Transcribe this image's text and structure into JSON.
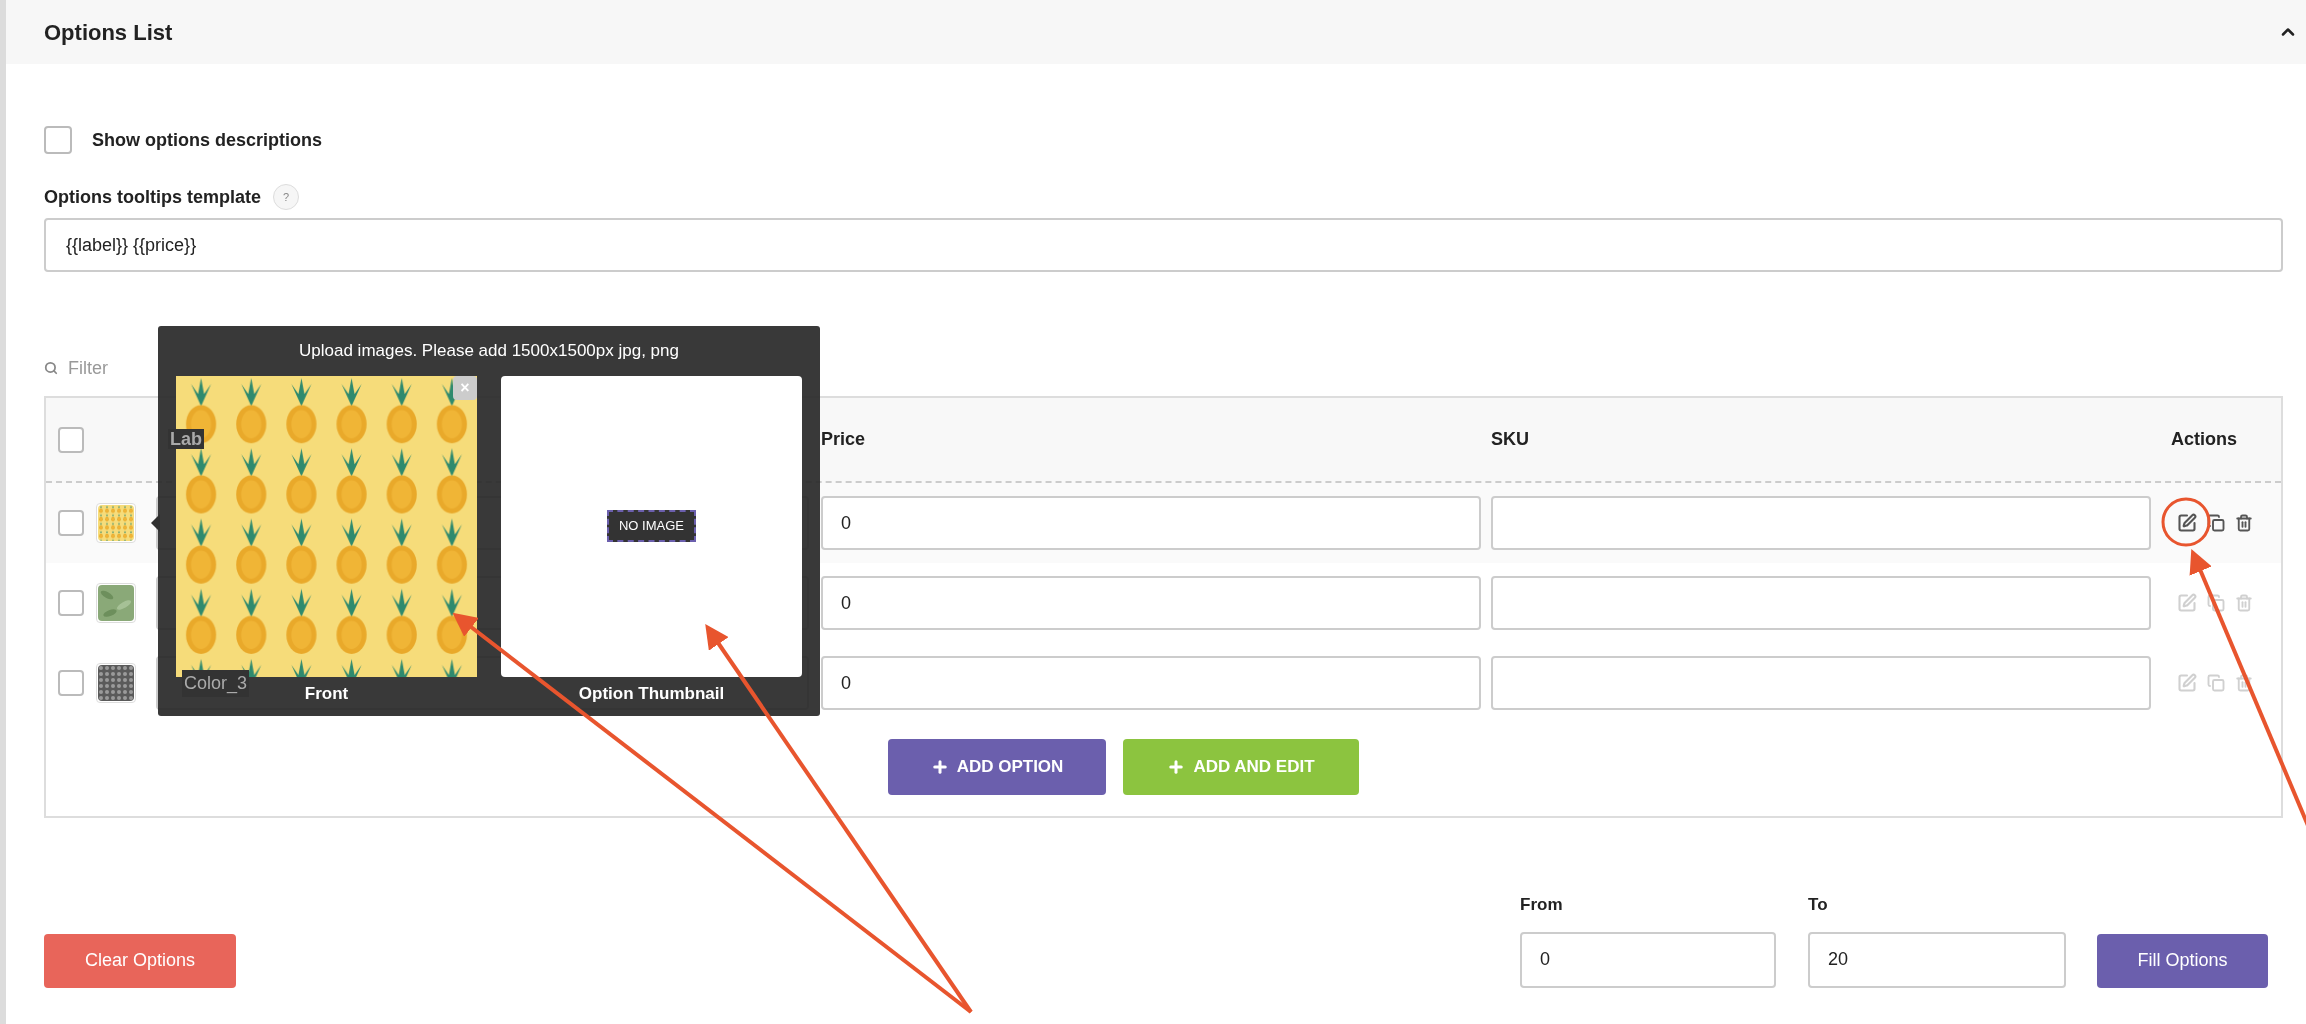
{
  "section": {
    "title": "Options List",
    "expanded": true
  },
  "show_descriptions": {
    "label": "Show options descriptions",
    "checked": false
  },
  "tooltip_template": {
    "label": "Options tooltips template",
    "help": "?",
    "value": "{{label}} {{price}}"
  },
  "filter": {
    "placeholder": "Filter"
  },
  "table": {
    "all_checked": false,
    "columns": [
      "Lab",
      "Price",
      "SKU",
      "Actions"
    ],
    "rows": [
      {
        "checked": false,
        "highlighted": true,
        "price": "0"
      },
      {
        "checked": false,
        "highlighted": false,
        "price": "0"
      },
      {
        "checked": false,
        "highlighted": false,
        "label": "Color_3",
        "price": "0"
      }
    ],
    "add_option": "ADD OPTION",
    "add_and_edit": "ADD AND EDIT"
  },
  "upload_popup": {
    "title": "Upload images. Please add 1500x1500px jpg, png",
    "close": "×",
    "slots": [
      {
        "label": "Front"
      },
      {
        "kind": "empty",
        "label": "Option Thumbnail",
        "badge": "NO IMAGE"
      }
    ]
  },
  "clear_button": "Clear Options",
  "range": {
    "from_label": "From",
    "from": "0",
    "to_label": "To",
    "to": "20"
  },
  "fill_button": "Fill Options"
}
